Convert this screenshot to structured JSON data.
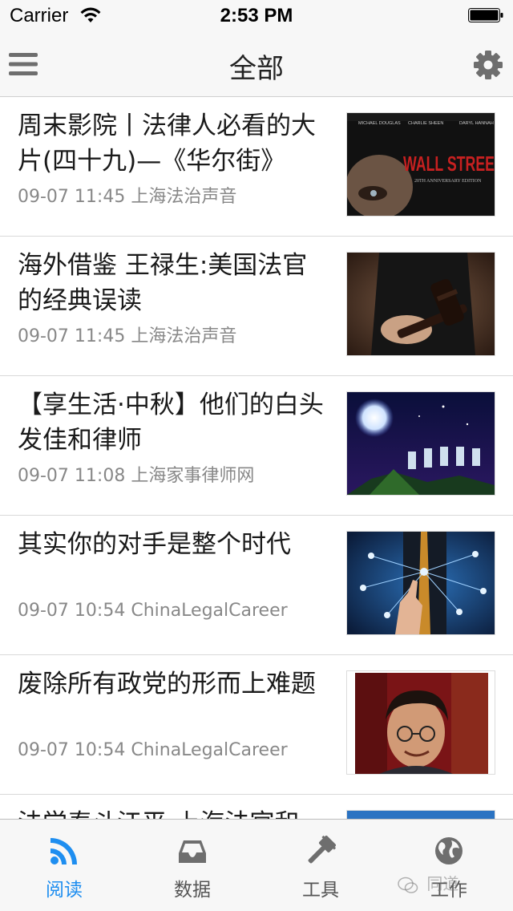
{
  "status_bar": {
    "carrier": "Carrier",
    "time": "2:53 PM"
  },
  "nav": {
    "title": "全部",
    "menu_icon": "hamburger-menu-icon",
    "settings_icon": "gear-icon"
  },
  "articles": [
    {
      "title": "周末影院丨法律人必看的大片(四十九)—《华尔街》",
      "date": "09-07 11:45",
      "source": "上海法治声音",
      "thumb": "wall-street-poster",
      "thumb_text": "WALL STREE",
      "thumb_names": [
        "MICHAEL DOUGLAS",
        "CHARLIE SHEEN",
        "DARYL HANNAH"
      ],
      "thumb_caption": "20TH ANNIVERSARY EDITION"
    },
    {
      "title": "海外借鉴 王禄生:美国法官的经典误读",
      "date": "09-07 11:45",
      "source": "上海法治声音",
      "thumb": "judge-gavel-photo"
    },
    {
      "title": "【享生活·中秋】他们的白头发佳和律师",
      "date": "09-07 11:08",
      "source": "上海家事律师网",
      "thumb": "moon-night-illustration"
    },
    {
      "title": "其实你的对手是整个时代",
      "date": "09-07 10:54",
      "source": "ChinaLegalCareer",
      "thumb": "network-touch-photo"
    },
    {
      "title": "废除所有政党的形而上难题",
      "date": "09-07 10:54",
      "source": "ChinaLegalCareer",
      "thumb": "portrait-photo"
    },
    {
      "title": "法学泰斗江平:上海法官和",
      "date": "",
      "source": "",
      "thumb": "blue-photo"
    }
  ],
  "tabs": [
    {
      "label": "阅读",
      "icon": "rss-feed-icon",
      "active": true
    },
    {
      "label": "数据",
      "icon": "inbox-tray-icon",
      "active": false
    },
    {
      "label": "工具",
      "icon": "gavel-icon",
      "active": false
    },
    {
      "label": "工作",
      "icon": "globe-icon",
      "active": false
    }
  ],
  "watermark": "同道",
  "colors": {
    "accent": "#1e8ef0",
    "tab_inactive": "#555555",
    "meta_text": "#888888"
  }
}
